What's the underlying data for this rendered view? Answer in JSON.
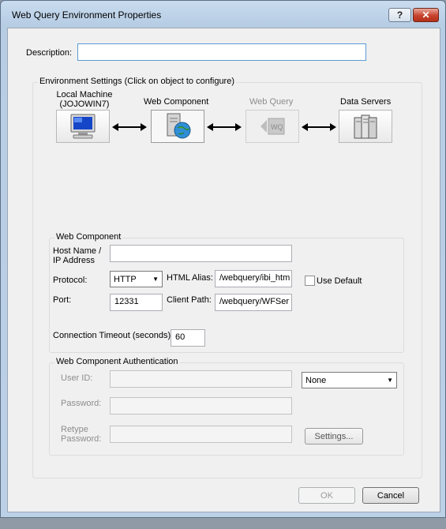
{
  "window": {
    "title": "Web Query Environment Properties",
    "help_glyph": "?",
    "close_glyph": "✕"
  },
  "description": {
    "label": "Description:",
    "value": ""
  },
  "environment": {
    "group_title": "Environment Settings (Click on object to configure)",
    "nodes": [
      {
        "label": "Local Machine\n(JOJOWIN7)",
        "icon": "computer-icon",
        "state": "normal"
      },
      {
        "label": "Web Component",
        "icon": "web-server-globe-icon",
        "state": "selected"
      },
      {
        "label": "Web Query",
        "icon": "web-query-icon",
        "state": "disabled"
      },
      {
        "label": "Data Servers",
        "icon": "data-servers-icon",
        "state": "normal"
      }
    ],
    "icon_wq_text": "WQ"
  },
  "web_component": {
    "group_title": "Web Component",
    "host_label": "Host Name /\nIP Address",
    "host_value": "",
    "protocol_label": "Protocol:",
    "protocol_value": "HTTP",
    "html_alias_label": "HTML Alias:",
    "html_alias_value": "/webquery/ibi_htm",
    "use_default_label": "Use Default",
    "use_default_checked": false,
    "port_label": "Port:",
    "port_value": "12331",
    "client_path_label": "Client Path:",
    "client_path_value": "/webquery/WFSer",
    "timeout_label": "Connection Timeout (seconds)",
    "timeout_value": "60"
  },
  "authentication": {
    "group_title": "Web Component Authentication",
    "user_id_label": "User ID:",
    "user_id_value": "",
    "password_label": "Password:",
    "password_value": "",
    "retype_label": "Retype\nPassword:",
    "retype_value": "",
    "mode_value": "None",
    "settings_label": "Settings..."
  },
  "footer": {
    "ok_label": "OK",
    "cancel_label": "Cancel"
  }
}
